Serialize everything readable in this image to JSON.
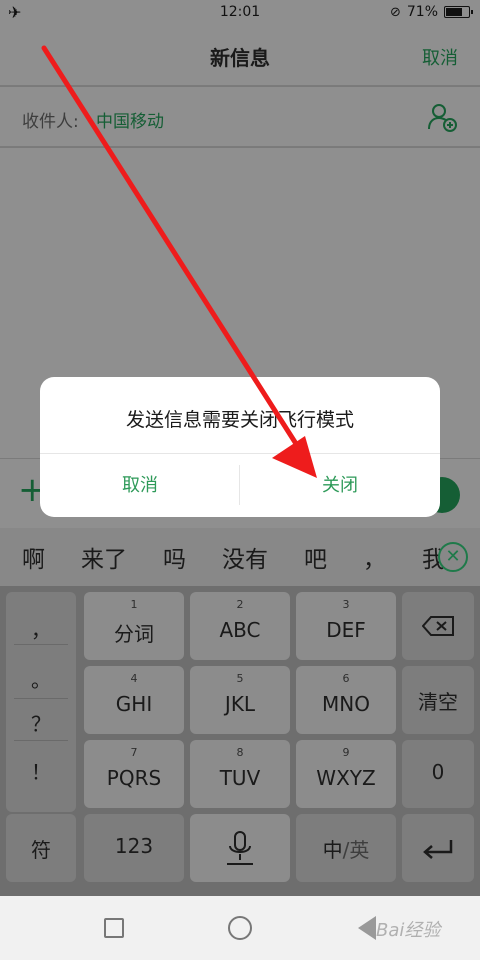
{
  "status_bar": {
    "time": "12:01",
    "battery": "71%",
    "battery_level": 0.71
  },
  "header": {
    "title": "新信息",
    "cancel_label": "取消"
  },
  "recipient": {
    "label": "收件人:",
    "value": "中国移动"
  },
  "input_row": {
    "plus": "+"
  },
  "candidates": [
    "啊",
    "来了",
    "吗",
    "没有",
    "吧",
    "，",
    "我"
  ],
  "keyboard": {
    "punctuation": [
      "，",
      "。",
      "？",
      "！"
    ],
    "rows": [
      [
        {
          "num": "1",
          "label": "分词"
        },
        {
          "num": "2",
          "label": "ABC"
        },
        {
          "num": "3",
          "label": "DEF"
        }
      ],
      [
        {
          "num": "4",
          "label": "GHI"
        },
        {
          "num": "5",
          "label": "JKL"
        },
        {
          "num": "6",
          "label": "MNO"
        }
      ],
      [
        {
          "num": "7",
          "label": "PQRS"
        },
        {
          "num": "8",
          "label": "TUV"
        },
        {
          "num": "9",
          "label": "WXYZ"
        }
      ]
    ],
    "clear": "清空",
    "zero": "0",
    "symbol": "符",
    "num123": "123",
    "lang_zh": "中",
    "lang_sep": "/",
    "lang_en": "英"
  },
  "dialog": {
    "message": "发送信息需要关闭飞行模式",
    "cancel": "取消",
    "confirm": "关闭"
  },
  "watermark": "Bai经验",
  "colors": {
    "accent_green": "#2e9a59",
    "annotation_red": "#ee1c1c"
  }
}
